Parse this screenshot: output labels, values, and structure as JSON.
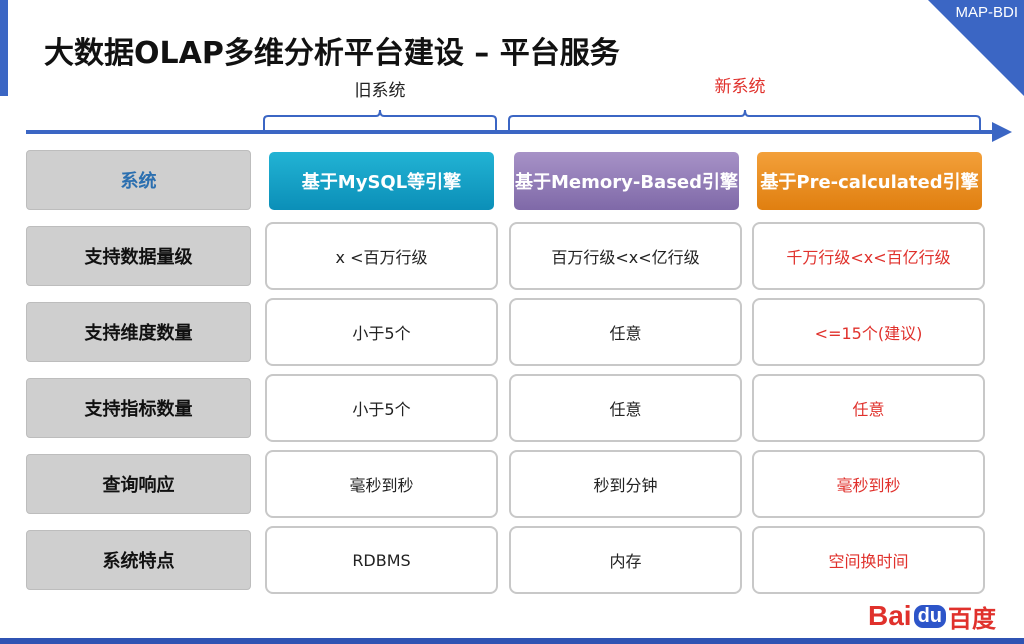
{
  "corner_label": "MAP-BDI",
  "title": "大数据OLAP多维分析平台建设 – 平台服务",
  "timeline": {
    "old_label": "旧系统",
    "new_label": "新系统"
  },
  "table": {
    "header": [
      "系统",
      "基于MySQL等引擎",
      "基于Memory-Based引擎",
      "基于Pre-calculated引擎"
    ],
    "rows": [
      {
        "label": "支持数据量级",
        "cells": [
          "x <百万行级",
          "百万行级<x<亿行级",
          "千万行级<x<百亿行级"
        ]
      },
      {
        "label": "支持维度数量",
        "cells": [
          "小于5个",
          "任意",
          "<=15个(建议)"
        ]
      },
      {
        "label": "支持指标数量",
        "cells": [
          "小于5个",
          "任意",
          "任意"
        ]
      },
      {
        "label": "查询响应",
        "cells": [
          "毫秒到秒",
          "秒到分钟",
          "毫秒到秒"
        ]
      },
      {
        "label": "系统特点",
        "cells": [
          "RDBMS",
          "内存",
          "空间换时间"
        ]
      }
    ]
  },
  "logo": {
    "latin": "Bai",
    "badge": "du",
    "chinese": "百度"
  },
  "colors": {
    "accent_blue": "#3b66c4",
    "new_red": "#e0312c",
    "mysql_cyan": "#0b8fb8",
    "memory_purple": "#8c78b3",
    "precalc_orange": "#e8891a"
  }
}
